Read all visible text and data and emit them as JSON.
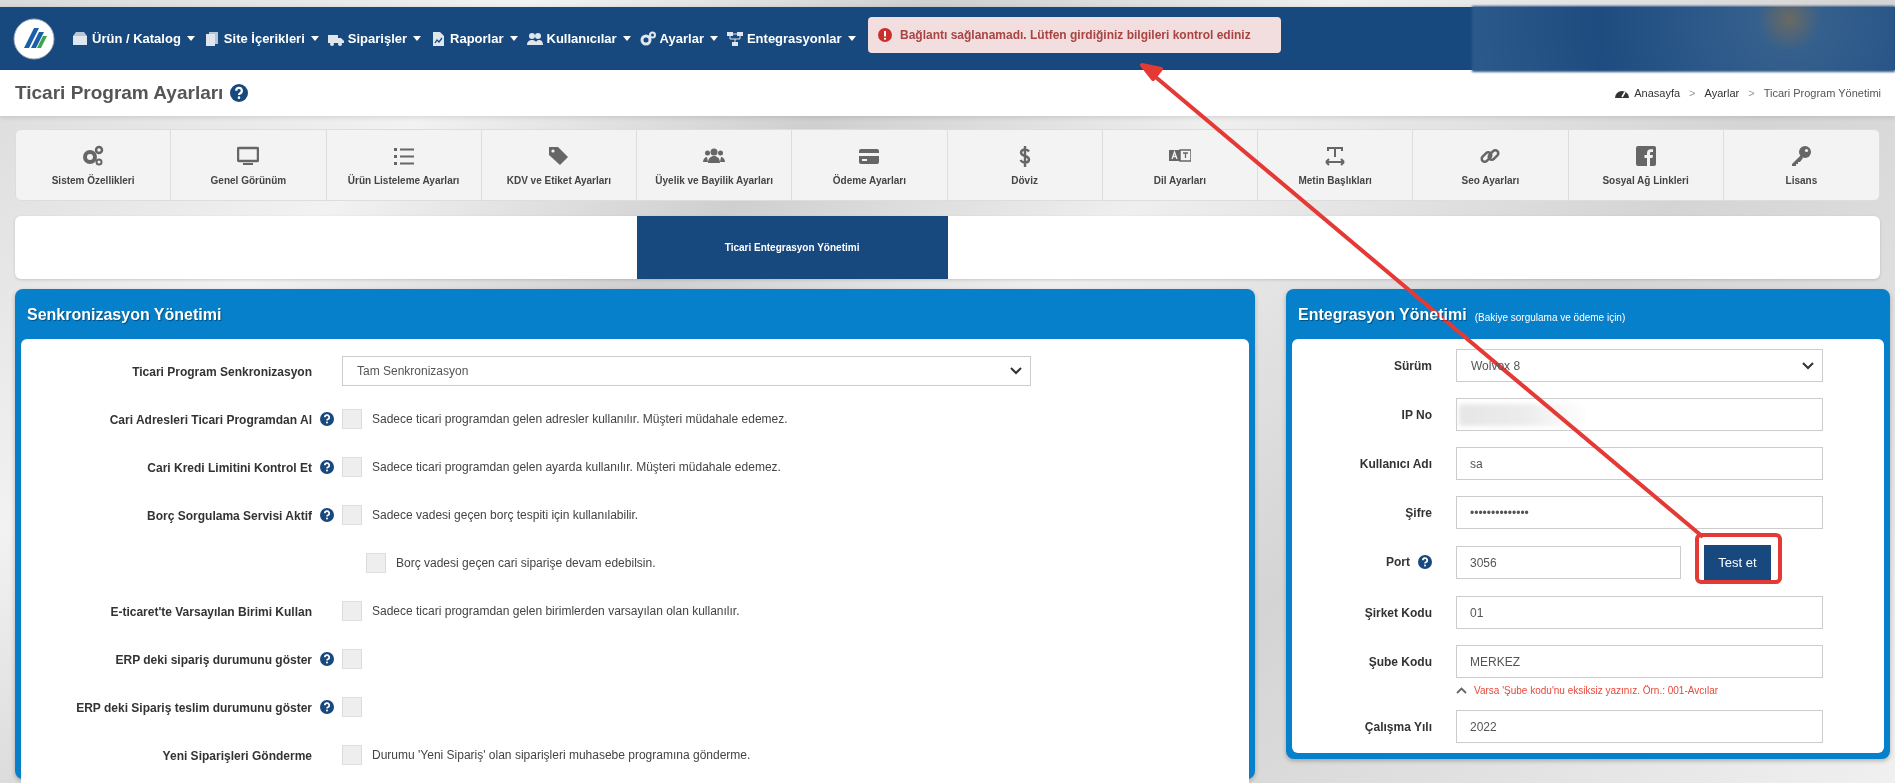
{
  "nav": {
    "items": [
      {
        "label": "Ürün / Katalog"
      },
      {
        "label": "Site İçerikleri"
      },
      {
        "label": "Siparişler"
      },
      {
        "label": "Raporlar"
      },
      {
        "label": "Kullanıcılar"
      },
      {
        "label": "Ayarlar"
      },
      {
        "label": "Entegrasyonlar"
      }
    ]
  },
  "alert": {
    "text": "Bağlantı sağlanamadı. Lütfen girdiğiniz bilgileri kontrol ediniz"
  },
  "page_title": "Ticari Program Ayarları",
  "breadcrumb": [
    {
      "kind": "link",
      "label": "Anasayfa"
    },
    {
      "kind": "separator",
      "label": ">"
    },
    {
      "kind": "link",
      "label": "Ayarlar"
    },
    {
      "kind": "separator",
      "label": ">"
    },
    {
      "kind": "current",
      "label": "Ticari Program Yönetimi"
    }
  ],
  "settings_tabs": [
    {
      "label": "Sistem Özellikleri",
      "selected": false
    },
    {
      "label": "Genel Görünüm",
      "selected": false
    },
    {
      "label": "Ürün Listeleme Ayarları",
      "selected": false
    },
    {
      "label": "KDV ve Etiket Ayarları",
      "selected": false
    },
    {
      "label": "Üyelik ve Bayilik Ayarları",
      "selected": false
    },
    {
      "label": "Ödeme Ayarları",
      "selected": false
    },
    {
      "label": "Döviz",
      "selected": false
    },
    {
      "label": "Dil Ayarları",
      "selected": false
    },
    {
      "label": "Metin Başlıkları",
      "selected": false
    },
    {
      "label": "Seo Ayarları",
      "selected": false
    },
    {
      "label": "Sosyal Ağ Linkleri",
      "selected": false
    },
    {
      "label": "Lisans",
      "selected": false
    }
  ],
  "sub_tabs": [
    {
      "label": "Ticari Entegrasyon Yönetimi",
      "selected": true
    }
  ],
  "sync_panel": {
    "title": "Senkronizasyon Yönetimi",
    "rows": [
      {
        "kind": "select",
        "label": "Ticari Program Senkronizasyon",
        "help": false,
        "value": "Tam Senkronizasyon"
      },
      {
        "kind": "checkbox",
        "label": "Cari Adresleri Ticari Programdan Al",
        "help": true,
        "checked": false,
        "note": "Sadece ticari programdan gelen adresler kullanılır. Müşteri müdahale edemez."
      },
      {
        "kind": "checkbox",
        "label": "Cari Kredi Limitini Kontrol Et",
        "help": true,
        "checked": false,
        "note": "Sadece ticari programdan gelen ayarda kullanılır. Müşteri müdahale edemez."
      },
      {
        "kind": "checkbox",
        "label": "Borç Sorgulama Servisi Aktif",
        "help": true,
        "checked": false,
        "note": "Sadece vadesi geçen borç tespiti için kullanılabilir."
      },
      {
        "kind": "subcheckbox",
        "checked": false,
        "note": "Borç vadesi geçen cari siparişe devam edebilsin."
      },
      {
        "kind": "checkbox",
        "label": "E-ticaret'te Varsayılan Birimi Kullan",
        "help": false,
        "checked": false,
        "note": "Sadece ticari programdan gelen birimlerden varsayılan olan kullanılır."
      },
      {
        "kind": "checkbox",
        "label": "ERP deki sipariş durumunu göster",
        "help": true,
        "checked": false
      },
      {
        "kind": "checkbox",
        "label": "ERP deki Sipariş teslim durumunu göster",
        "help": true,
        "checked": false
      },
      {
        "kind": "checkbox",
        "label": "Yeni Siparişleri Gönderme",
        "help": false,
        "checked": false,
        "note": "Durumu 'Yeni Sipariş' olan siparişleri muhasebe programına gönderme."
      }
    ]
  },
  "integration_panel": {
    "title": "Entegrasyon Yönetimi",
    "subtitle": "(Bakiye sorgulama ve ödeme için)",
    "fields": [
      {
        "kind": "select",
        "label": "Sürüm",
        "help": false,
        "value": "Wolvox 8"
      },
      {
        "kind": "redacted",
        "label": "IP No",
        "help": false
      },
      {
        "kind": "input",
        "label": "Kullanıcı Adı",
        "help": false,
        "value": "sa"
      },
      {
        "kind": "input",
        "label": "Şifre",
        "help": false,
        "value": "••••••••••••••"
      },
      {
        "kind": "input",
        "label": "Port",
        "help": true,
        "value": "3056",
        "button": "Test et"
      },
      {
        "kind": "input",
        "label": "Şirket Kodu",
        "help": false,
        "value": "01"
      },
      {
        "kind": "input",
        "label": "Şube Kodu",
        "help": false,
        "value": "MERKEZ",
        "hint": "Varsa 'Şube kodu'nu eksiksiz yazınız. Örn.: 001-Avcılar"
      },
      {
        "kind": "input",
        "label": "Çalışma Yılı",
        "help": false,
        "value": "2022"
      }
    ]
  }
}
